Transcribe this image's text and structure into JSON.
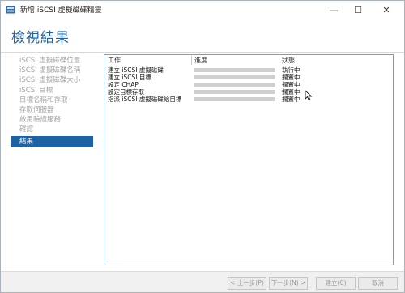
{
  "window": {
    "title": "新增 iSCSI 虛擬磁碟精靈"
  },
  "window_controls": {
    "minimize": "—",
    "maximize": "☐",
    "close": "✕"
  },
  "page_title": "檢視結果",
  "nav": [
    {
      "label": "iSCSI 虛擬磁碟位置",
      "active": false
    },
    {
      "label": "iSCSI 虛擬磁碟名稱",
      "active": false
    },
    {
      "label": "iSCSI 虛擬磁碟大小",
      "active": false
    },
    {
      "label": "iSCSI 目標",
      "active": false
    },
    {
      "label": "目標名稱和存取",
      "active": false
    },
    {
      "label": "存取伺服器",
      "active": false
    },
    {
      "label": "啟用驗證服務",
      "active": false
    },
    {
      "label": "確認",
      "active": false
    },
    {
      "label": "結果",
      "active": true
    }
  ],
  "table": {
    "headers": {
      "task": "工作",
      "progress": "進度",
      "status": "狀態"
    },
    "rows": [
      {
        "task": "建立 iSCSI 虛擬磁碟",
        "status": "執行中"
      },
      {
        "task": "建立 iSCSI 目標",
        "status": "擱置中"
      },
      {
        "task": "設定 CHAP",
        "status": "擱置中"
      },
      {
        "task": "設定目標存取",
        "status": "擱置中"
      },
      {
        "task": "指派 iSCSI 虛擬磁碟給目標",
        "status": "擱置中"
      }
    ]
  },
  "footer": {
    "prev": "< 上一步(P)",
    "next": "下一步(N) >",
    "create": "建立(C)",
    "cancel": "取消"
  },
  "colors": {
    "accent": "#1e62a6",
    "grid_border": "#7a9bc2",
    "progress_bar": "#cfcfcf"
  }
}
